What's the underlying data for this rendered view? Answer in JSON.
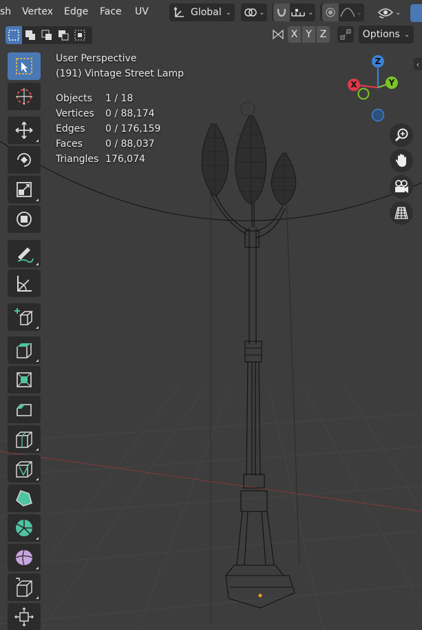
{
  "menu": {
    "items": [
      "sh",
      "Vertex",
      "Edge",
      "Face",
      "UV"
    ]
  },
  "header": {
    "orientation": "Global",
    "options_label": "Options"
  },
  "axis_buttons": [
    "X",
    "Y",
    "Z"
  ],
  "overlay": {
    "view_name": "User Perspective",
    "object_name": "(191) Vintage Street Lamp",
    "stats": [
      {
        "label": "Objects",
        "value": "1 / 18"
      },
      {
        "label": "Vertices",
        "value": "0 / 88,174"
      },
      {
        "label": "Edges",
        "value": "0 / 176,159"
      },
      {
        "label": "Faces",
        "value": "0 / 88,037"
      },
      {
        "label": "Triangles",
        "value": "176,074"
      }
    ]
  },
  "gizmo": {
    "x_label": "X",
    "y_label": "Y",
    "z_label": "Z",
    "x_color": "#e0384a",
    "y_color": "#7ec428",
    "z_color": "#3a82d6"
  },
  "toolbar": {
    "tools": [
      "select-box",
      "cursor",
      "move",
      "rotate",
      "scale",
      "transform",
      "annotate",
      "measure",
      "add-cube",
      "extrude",
      "inset",
      "bevel",
      "loop-cut",
      "knife",
      "poly-build",
      "spin",
      "smooth",
      "shear",
      "shrink-fatten"
    ],
    "active_tool": "select-box"
  },
  "colors": {
    "viewport_bg": "#3d3d3d",
    "accent": "#4a78b5",
    "widget_bg": "#2b2b2b"
  }
}
